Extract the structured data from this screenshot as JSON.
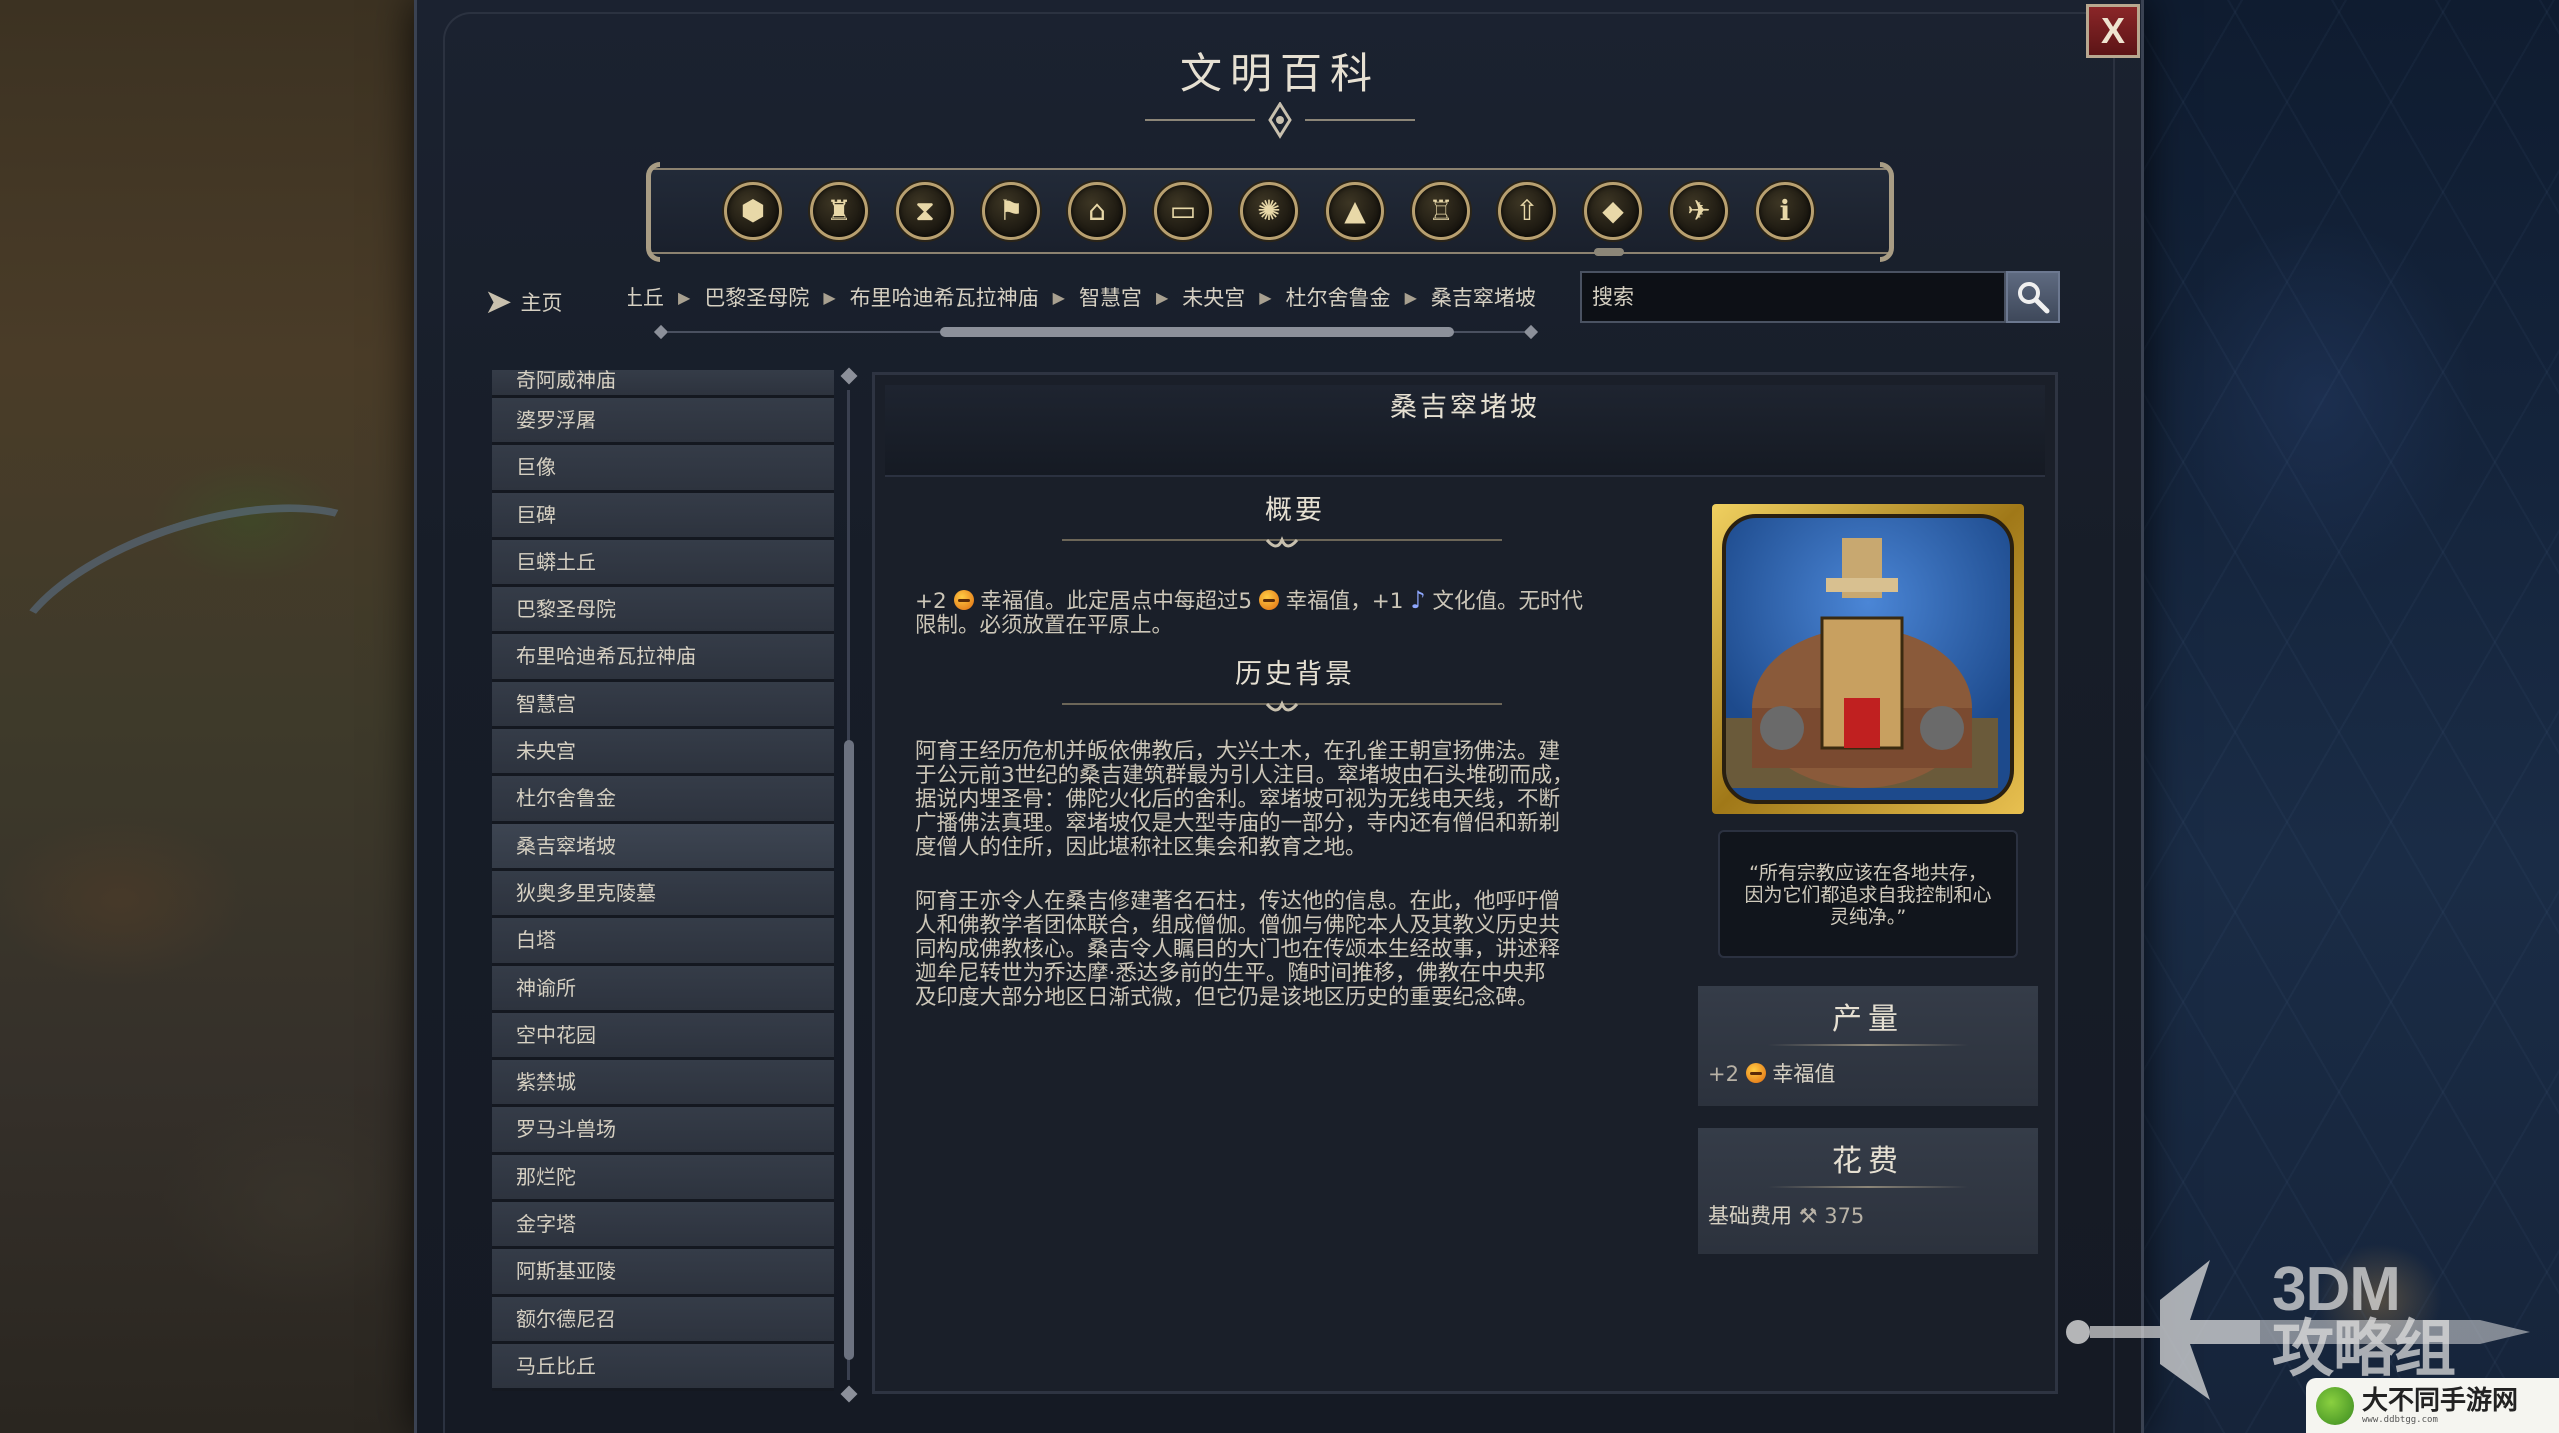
{
  "window": {
    "title": "文明百科",
    "close_label": "X"
  },
  "categories": [
    {
      "icon": "resources-icon",
      "glyph": "⬢"
    },
    {
      "icon": "goblet-icon",
      "glyph": "♜"
    },
    {
      "icon": "hourglass-icon",
      "glyph": "⧗"
    },
    {
      "icon": "flag-icon",
      "glyph": "⚑"
    },
    {
      "icon": "building-icon",
      "glyph": "⌂"
    },
    {
      "icon": "book-icon",
      "glyph": "▭"
    },
    {
      "icon": "atom-icon",
      "glyph": "✺"
    },
    {
      "icon": "mountain-icon",
      "glyph": "▲"
    },
    {
      "icon": "city-icon",
      "glyph": "♖"
    },
    {
      "icon": "upgrade-arrow-icon",
      "glyph": "⇧"
    },
    {
      "icon": "wonder-icon",
      "glyph": "◆"
    },
    {
      "icon": "dove-icon",
      "glyph": "✈"
    },
    {
      "icon": "info-icon",
      "glyph": "ℹ"
    }
  ],
  "nav": {
    "home_label": "主页",
    "breadcrumbs": [
      "土丘",
      "巴黎圣母院",
      "布里哈迪希瓦拉神庙",
      "智慧宫",
      "未央宫",
      "杜尔舍鲁金",
      "桑吉窣堵坡"
    ],
    "search_placeholder": "搜索"
  },
  "list": {
    "items": [
      "奇阿威神庙",
      "婆罗浮屠",
      "巨像",
      "巨碑",
      "巨蟒土丘",
      "巴黎圣母院",
      "布里哈迪希瓦拉神庙",
      "智慧宫",
      "未央宫",
      "杜尔舍鲁金",
      "桑吉窣堵坡",
      "狄奥多里克陵墓",
      "白塔",
      "神谕所",
      "空中花园",
      "紫禁城",
      "罗马斗兽场",
      "那烂陀",
      "金字塔",
      "阿斯基亚陵",
      "额尔德尼召",
      "马丘比丘"
    ],
    "selected": "桑吉窣堵坡"
  },
  "article": {
    "title": "桑吉窣堵坡",
    "summary_heading": "概要",
    "summary": {
      "p1": "+2",
      "p2": "幸福值。此定居点中每超过5",
      "p3": "幸福值，+1",
      "p4": "文化值。无时代",
      "line2": "限制。必须放置在平原上。"
    },
    "history_heading": "历史背景",
    "history_p1": [
      "阿育王经历危机并皈依佛教后，大兴土木，在孔雀王朝宣扬佛法。建",
      "于公元前3世纪的桑吉建筑群最为引人注目。窣堵坡由石头堆砌而成，",
      "据说内埋圣骨：佛陀火化后的舍利。窣堵坡可视为无线电天线，不断",
      "广播佛法真理。窣堵坡仅是大型寺庙的一部分，寺内还有僧侣和新剃",
      "度僧人的住所，因此堪称社区集会和教育之地。"
    ],
    "history_p2": [
      "阿育王亦令人在桑吉修建著名石柱，传达他的信息。在此，他呼吁僧",
      "人和佛教学者团体联合，组成僧伽。僧伽与佛陀本人及其教义历史共",
      "同构成佛教核心。桑吉令人瞩目的大门也在传颂本生经故事，讲述释",
      "迦牟尼转世为乔达摩·悉达多前的生平。随时间推移，佛教在中央邦",
      "及印度大部分地区日渐式微，但它仍是该地区历史的重要纪念碑。"
    ]
  },
  "sidebar": {
    "quote": "“所有宗教应该在各地共存，因为它们都追求自我控制和心灵纯净。”",
    "yield_heading": "产量",
    "yield_amount": "+2",
    "yield_label": "幸福值",
    "cost_heading": "花费",
    "cost_label": "基础费用",
    "cost_value": "375"
  },
  "watermarks": {
    "brand_line1": "3DM",
    "brand_line2": "攻略组",
    "site_name": "大不同手游网",
    "site_url": "www.ddbtgg.com"
  },
  "colors": {
    "accent_gold": "#b8a070",
    "close_red": "#8a2628",
    "panel_bg": "#171d28",
    "list_item_bg": "#353c48"
  }
}
